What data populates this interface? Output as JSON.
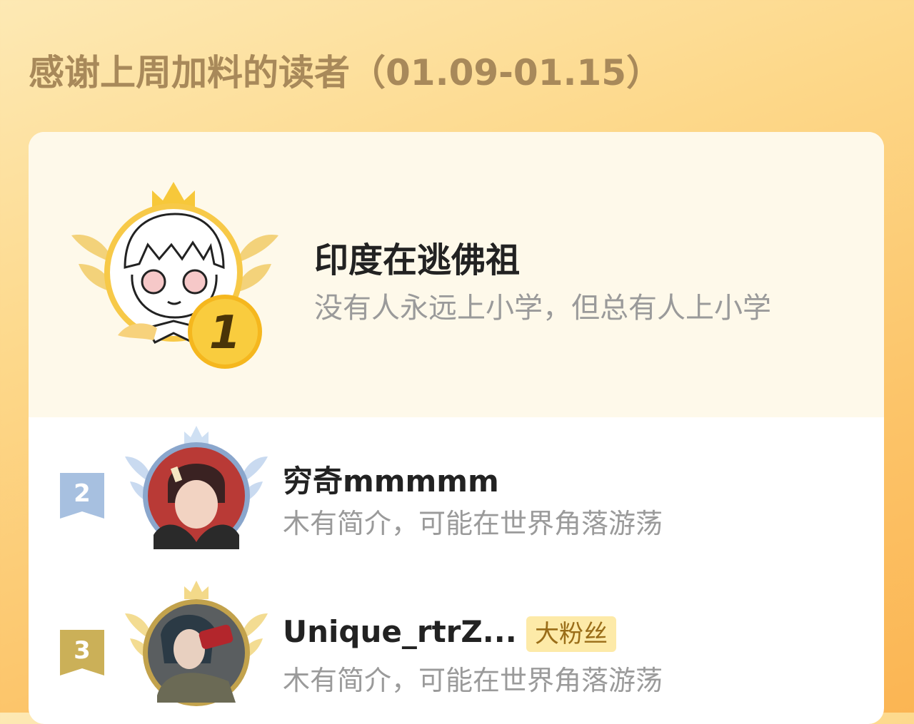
{
  "header": {
    "title": "感谢上周加料的读者（01.09-01.15）"
  },
  "readers": [
    {
      "rank": "1",
      "name": "印度在逃佛祖",
      "desc": "没有人永远上小学，但总有人上小学",
      "avatar_icon": "cartoon-avatar-icon"
    },
    {
      "rank": "2",
      "name": "穷奇mmmmm",
      "desc": "木有简介，可能在世界角落游荡",
      "avatar_icon": "anime-avatar-icon"
    },
    {
      "rank": "3",
      "name": "Unique_rtrZ...",
      "desc": "木有简介，可能在世界角落游荡",
      "badge": "大粉丝",
      "avatar_icon": "anime-avatar-icon"
    }
  ],
  "colors": {
    "gold": "#f5b71e",
    "silver": "#9fb8d8",
    "bronze": "#c8a64a",
    "badge_bg": "#fdeaa8"
  }
}
